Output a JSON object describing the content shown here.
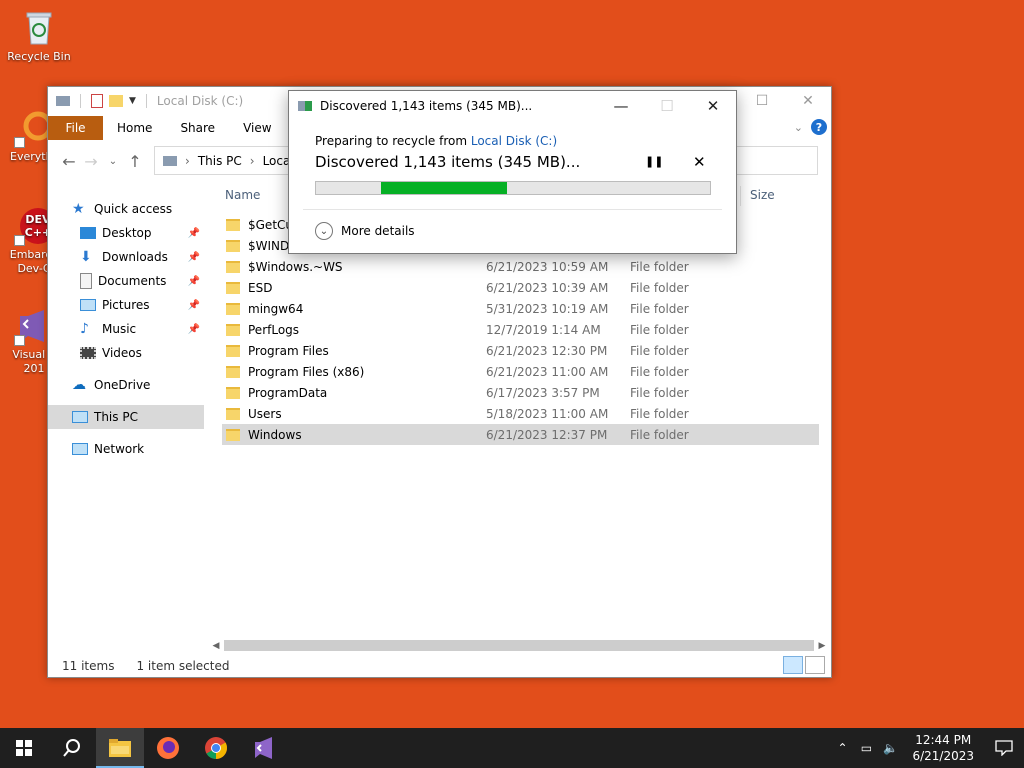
{
  "desktop": {
    "icons": [
      {
        "label": "Recycle Bin"
      },
      {
        "label": "Everyth"
      },
      {
        "label": "Embarca\nDev-C"
      },
      {
        "label": "Visual S\n201"
      }
    ]
  },
  "explorer": {
    "title": "Local Disk (C:)",
    "tabs": {
      "file": "File",
      "home": "Home",
      "share": "Share",
      "view": "View"
    },
    "breadcrumb": {
      "this_pc": "This PC",
      "local": "Local Disk (C:)"
    },
    "nav": {
      "quick_access": "Quick access",
      "desktop": "Desktop",
      "downloads": "Downloads",
      "documents": "Documents",
      "pictures": "Pictures",
      "music": "Music",
      "videos": "Videos",
      "onedrive": "OneDrive",
      "this_pc": "This PC",
      "network": "Network"
    },
    "columns": {
      "name": "Name",
      "size": "Size"
    },
    "files": [
      {
        "name": "$GetCurrent",
        "date": "",
        "type": ""
      },
      {
        "name": "$WINDOWS.~BT",
        "date": "",
        "type": ""
      },
      {
        "name": "$Windows.~WS",
        "date": "6/21/2023 10:59 AM",
        "type": "File folder"
      },
      {
        "name": "ESD",
        "date": "6/21/2023 10:39 AM",
        "type": "File folder"
      },
      {
        "name": "mingw64",
        "date": "5/31/2023 10:19 AM",
        "type": "File folder"
      },
      {
        "name": "PerfLogs",
        "date": "12/7/2019 1:14 AM",
        "type": "File folder"
      },
      {
        "name": "Program Files",
        "date": "6/21/2023 12:30 PM",
        "type": "File folder"
      },
      {
        "name": "Program Files (x86)",
        "date": "6/21/2023 11:00 AM",
        "type": "File folder"
      },
      {
        "name": "ProgramData",
        "date": "6/17/2023 3:57 PM",
        "type": "File folder"
      },
      {
        "name": "Users",
        "date": "5/18/2023 11:00 AM",
        "type": "File folder"
      },
      {
        "name": "Windows",
        "date": "6/21/2023 12:37 PM",
        "type": "File folder"
      }
    ],
    "status": {
      "items": "11 items",
      "selected": "1 item selected"
    }
  },
  "dialog": {
    "title": "Discovered 1,143 items (345 MB)...",
    "sub_prefix": "Preparing to recycle from ",
    "sub_link": "Local Disk (C:)",
    "main": "Discovered 1,143 items (345 MB)...",
    "progress_start": 0.165,
    "progress_end": 0.485,
    "more_details": "More details"
  },
  "taskbar": {
    "time": "12:44 PM",
    "date": "6/21/2023"
  }
}
